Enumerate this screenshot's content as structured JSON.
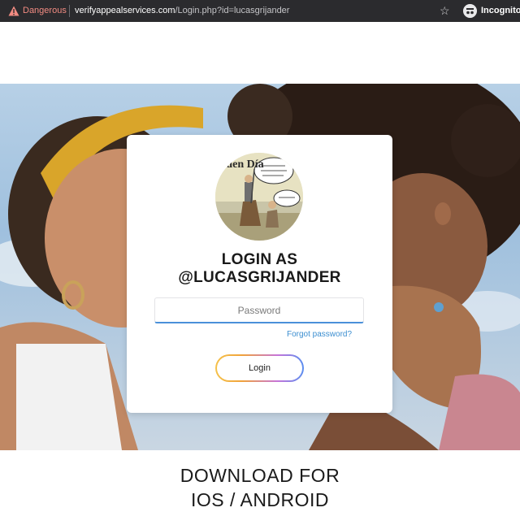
{
  "browser": {
    "security_label": "Dangerous",
    "url_host": "verifyappealservices.com",
    "url_path": "/Login.php?id=lucasgrijander",
    "incognito_label": "Incognito",
    "bookmark_icon": "star-icon",
    "warning_icon": "warning-triangle-icon",
    "incognito_icon": "incognito-icon"
  },
  "login": {
    "title_line1": "LOGIN AS",
    "title_line2": "@LUCASGRIJANDER",
    "password_placeholder": "Password",
    "password_value": "",
    "forgot_label": "Forgot password?",
    "login_label": "Login",
    "avatar_text": "Buen Día"
  },
  "download": {
    "line1": "DOWNLOAD FOR",
    "line2": "IOS / ANDROID"
  },
  "colors": {
    "danger": "#f28b82",
    "link": "#3b8ed0",
    "input_focus": "#4a90d9"
  }
}
